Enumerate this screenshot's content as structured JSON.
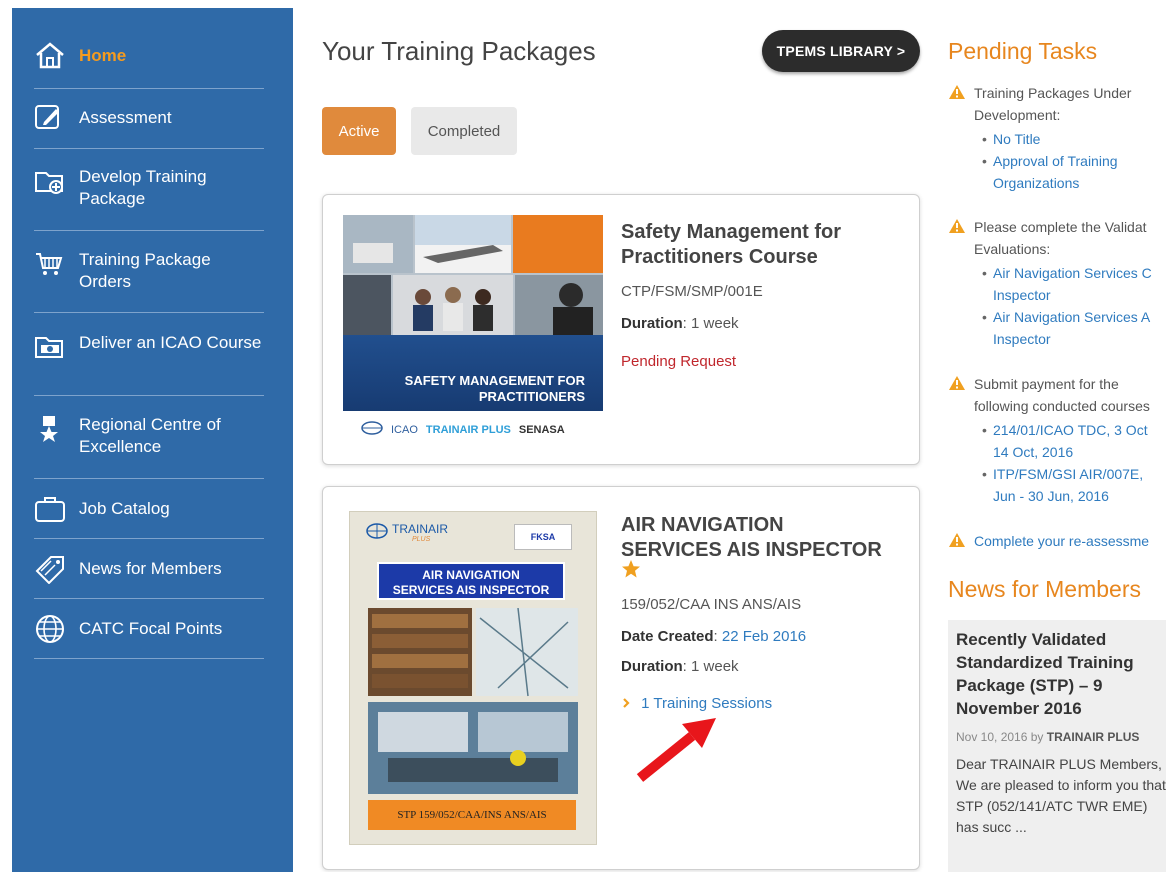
{
  "sidebar": {
    "items": [
      {
        "label": "Home",
        "icon": "home-icon"
      },
      {
        "label": "Assessment",
        "icon": "edit-icon"
      },
      {
        "label": "Develop Training Package",
        "icon": "folder-plus-icon"
      },
      {
        "label": "Training Package Orders",
        "icon": "cart-icon"
      },
      {
        "label": "Deliver an ICAO Course",
        "icon": "course-folder-icon"
      },
      {
        "label": "Regional Centre of Excellence",
        "icon": "award-icon"
      },
      {
        "label": "Job Catalog",
        "icon": "briefcase-icon"
      },
      {
        "label": "News for Members",
        "icon": "tag-icon"
      },
      {
        "label": "CATC Focal Points",
        "icon": "globe-icon"
      }
    ],
    "active_color": "#f59b1e",
    "background": "#2f6aa8"
  },
  "main": {
    "title": "Your Training Packages",
    "library_button": "TPEMS LIBRARY >",
    "tabs": [
      {
        "label": "Active",
        "selected": true
      },
      {
        "label": "Completed",
        "selected": false
      }
    ]
  },
  "packages": [
    {
      "title_line1": "Safety Management for",
      "title_line2": "Practitioners Course",
      "code": "CTP/FSM/SMP/001E",
      "duration_label": "Duration",
      "duration": "1 week",
      "status": "Pending Request",
      "cover": {
        "banner_line1": "SAFETY MANAGEMENT FOR",
        "banner_line2": "PRACTITIONERS",
        "logo1": "ICAO",
        "logo2": "TRAINAIR PLUS",
        "logo3": "SENASA"
      }
    },
    {
      "title_line1": "AIR NAVIGATION",
      "title_line2": "SERVICES AIS INSPECTOR",
      "code": "159/052/CAA INS ANS/AIS",
      "date_label": "Date Created",
      "date": "22 Feb 2016",
      "duration_label": "Duration",
      "duration": "1 week",
      "sessions": "1 Training Sessions",
      "cover": {
        "logo": "TRAINAIR",
        "logo_sub": "PLUS",
        "badge": "FKSA",
        "title_line1": "AIR NAVIGATION",
        "title_line2": "SERVICES AIS INSPECTOR",
        "footer": "STP 159/052/CAA/INS ANS/AIS"
      }
    }
  ],
  "pending_tasks": {
    "heading": "Pending Tasks",
    "tasks": [
      {
        "text_line1": "Training Packages Under",
        "text_line2": "Development:",
        "items": [
          [
            "No Title"
          ],
          [
            "Approval of Training",
            "Organizations"
          ]
        ]
      },
      {
        "text_line1": "Please complete the Validat",
        "text_line2": "Evaluations:",
        "items": [
          [
            "Air Navigation Services C",
            "Inspector"
          ],
          [
            "Air Navigation Services A",
            "Inspector"
          ]
        ]
      },
      {
        "text_line1": "Submit payment for the",
        "text_line2": "following conducted courses",
        "items": [
          [
            "214/01/ICAO TDC, 3 Oct",
            "14 Oct, 2016"
          ],
          [
            "ITP/FSM/GSI AIR/007E,",
            "Jun - 30 Jun, 2016"
          ]
        ]
      },
      {
        "link": "Complete your re-assessme"
      }
    ]
  },
  "news": {
    "heading": "News for Members",
    "title": "Recently Validated Standardized Training Package (STP) – 9 November 2016",
    "date": "Nov 10, 2016 by",
    "author": "TRAINAIR PLUS",
    "body": "Dear TRAINAIR PLUS Members, We are pleased to inform you that STP (052/141/ATC TWR EME) has succ ..."
  },
  "colors": {
    "accent_orange": "#e7861e",
    "link_blue": "#2f7bbf",
    "pending_red": "#c0272d",
    "warning_orange": "#f0a020",
    "annotation_arrow": "#e8161b"
  }
}
